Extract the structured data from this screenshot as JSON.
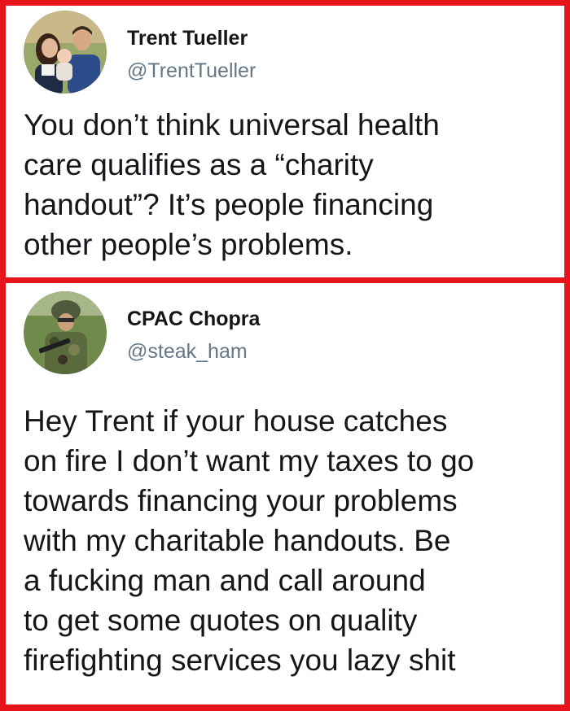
{
  "tweets": [
    {
      "display_name": "Trent Tueller",
      "handle": "@TrentTueller",
      "avatar_icon": "family-photo-avatar",
      "lines": [
        "You don’t think universal health",
        "care qualifies as a “charity",
        "handout”? It’s people financing",
        "other people’s problems."
      ]
    },
    {
      "display_name": "CPAC Chopra",
      "handle": "@steak_ham",
      "avatar_icon": "soldier-photo-avatar",
      "lines": [
        "Hey Trent if your house catches",
        "on fire I don’t want my taxes to go",
        "towards financing your problems",
        "with my charitable handouts. Be",
        "a fucking man and call around",
        "to get some quotes on quality",
        "firefighting services you lazy shit"
      ]
    }
  ],
  "colors": {
    "border": "#e8141c",
    "text": "#14171a",
    "handle": "#657786"
  }
}
